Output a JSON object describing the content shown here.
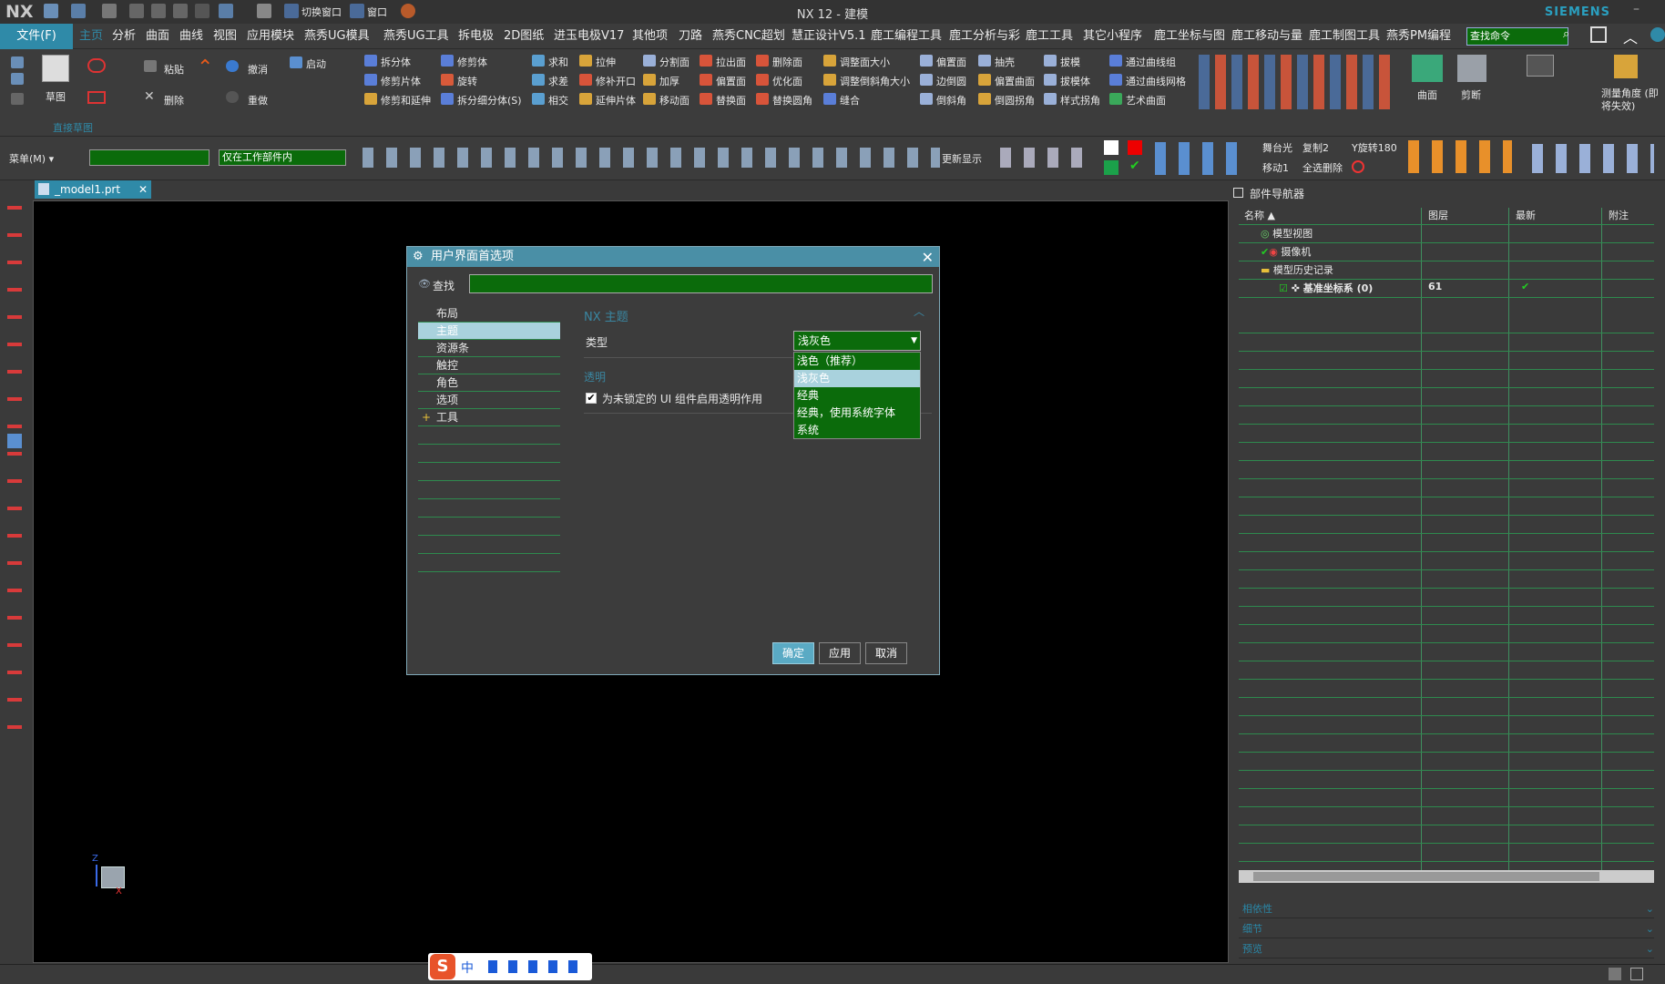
{
  "window": {
    "logo": "NX",
    "title": "NX 12 - 建模",
    "brand": "SIEMENS"
  },
  "quickaccess": {
    "switch_window": "切换窗口",
    "window": "窗口"
  },
  "menubar": {
    "file": "文件(F)",
    "items": [
      "主页",
      "分析",
      "曲面",
      "曲线",
      "视图",
      "应用模块",
      "燕秀UG模具",
      "燕秀UG工具",
      "拆电极",
      "2D图纸",
      "进玉电极V17",
      "其他项",
      "刀路",
      "燕秀CNC超划",
      "慧正设计V5.1",
      "鹿工编程工具",
      "鹿工分析与彩",
      "鹿工工具",
      "其它小程序",
      "鹿工坐标与图",
      "鹿工移动与量",
      "鹿工制图工具",
      "燕秀PM编程"
    ],
    "search_placeholder": "查找命令"
  },
  "ribbon": {
    "sketch": "草图",
    "direct_sketch": "直接草图",
    "paste": "粘贴",
    "delete": "删除",
    "undo": "撤消",
    "redo": "重做",
    "start": "启动",
    "groups": [
      [
        "拆分体",
        "修剪片体",
        "修剪和延伸"
      ],
      [
        "修剪体",
        "旋转",
        "拆分细分体(S)"
      ],
      [
        "求和",
        "求差",
        "相交"
      ],
      [
        "拉伸",
        "修补开口",
        "延伸片体"
      ],
      [
        "分割面",
        "加厚",
        "移动面"
      ],
      [
        "拉出面",
        "偏置面",
        "替换面"
      ],
      [
        "删除面",
        "优化面",
        "替换圆角"
      ],
      [
        "调整面大小",
        "调整倒斜角大小",
        "缝合"
      ],
      [
        "偏置面",
        "边倒圆",
        "倒斜角"
      ],
      [
        "抽壳",
        "偏置曲面",
        "倒圆拐角"
      ],
      [
        "拔模",
        "拔模体",
        "样式拐角"
      ],
      [
        "通过曲线组",
        "通过曲线网格",
        "艺术曲面"
      ]
    ],
    "surface": "曲面",
    "trim": "剪断",
    "measure": "测量角度 (即将失效)"
  },
  "toolbar2": {
    "menu": "菜单(M)",
    "filter_value": "",
    "scope": "仅在工作部件内",
    "update_display": "更新显示",
    "stage_light": "舞台光",
    "copy2": "复制2",
    "y_rotate": "Y旋转180",
    "move1": "移动1",
    "select_delete": "全选删除"
  },
  "doc_tab": {
    "label": "_model1.prt"
  },
  "dialog": {
    "title": "用户界面首选项",
    "find_label": "查找",
    "find_value": "",
    "tree": [
      "布局",
      "主题",
      "资源条",
      "触控",
      "角色",
      "选项",
      "工具"
    ],
    "selected_tree_index": 1,
    "section_title": "NX 主题",
    "type_label": "类型",
    "type_value": "浅灰色",
    "dropdown_options": [
      "浅色（推荐）",
      "浅灰色",
      "经典",
      "经典，使用系统字体",
      "系统"
    ],
    "selected_option_index": 1,
    "transparency_header": "透明",
    "transparency_label": "为未锁定的 UI 组件启用透明作用",
    "transparency_checked": true,
    "ok": "确定",
    "apply": "应用",
    "cancel": "取消"
  },
  "navigator": {
    "title": "部件导航器",
    "columns": [
      "名称",
      "图层",
      "最新",
      "附注"
    ],
    "rows": [
      {
        "name": "模型视图",
        "layer": "",
        "latest": ""
      },
      {
        "name": "摄像机",
        "layer": "",
        "latest": ""
      },
      {
        "name": "模型历史记录",
        "layer": "",
        "latest": ""
      },
      {
        "name": "基准坐标系 (0)",
        "layer": "61",
        "latest": "✔"
      }
    ],
    "collapsed_panels": [
      "相依性",
      "细节",
      "预览"
    ]
  },
  "axis": {
    "z": "Z",
    "x": "X"
  },
  "ime": {
    "lang": "中"
  },
  "colors": {
    "accent": "#2f8aa8",
    "green_field": "#0b6b0b",
    "grid_line": "#2e8a4e"
  }
}
